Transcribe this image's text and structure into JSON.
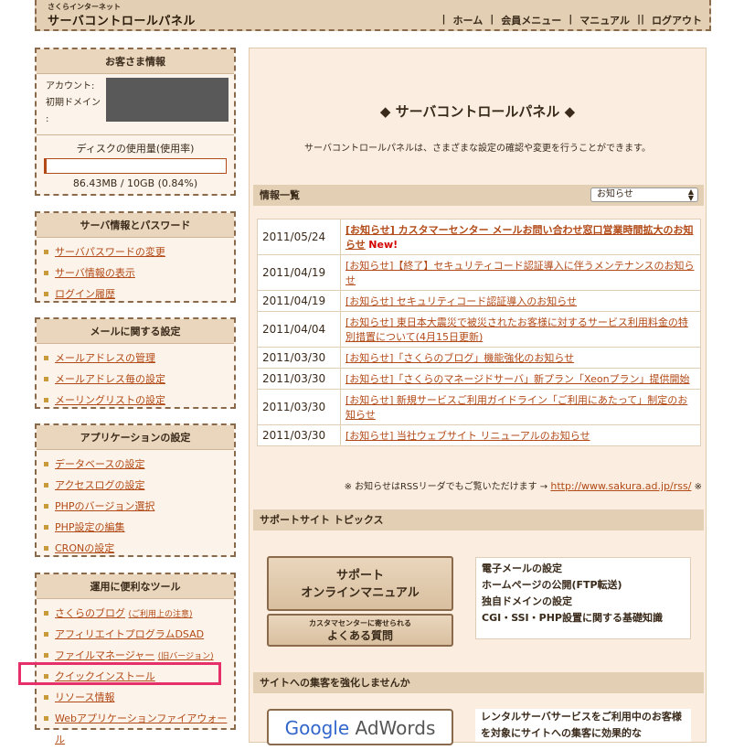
{
  "header": {
    "brand_small": "さくらインターネット",
    "brand_large": "サーバコントロールパネル",
    "nav": [
      "ホーム",
      "会員メニュー",
      "マニュアル",
      "ログアウト"
    ]
  },
  "customer": {
    "title": "お客さま情報",
    "account_label": "アカウント:",
    "domain_label_1": "初期ドメイン",
    "domain_label_2": ":",
    "disk_label": "ディスクの使用量(使用率)",
    "disk_usage": "86.43MB / 10GB (0.84%)",
    "disk_fraction": 0.0084
  },
  "server_info": {
    "title": "サーバ情報とパスワード",
    "items": [
      "サーバパスワードの変更",
      "サーバ情報の表示",
      "ログイン履歴"
    ]
  },
  "mail": {
    "title": "メールに関する設定",
    "items": [
      "メールアドレスの管理",
      "メールアドレス毎の設定",
      "メーリングリストの設定"
    ]
  },
  "apps": {
    "title": "アプリケーションの設定",
    "items": [
      "データベースの設定",
      "アクセスログの設定",
      "PHPのバージョン選択",
      "PHP設定の編集",
      "CRONの設定"
    ]
  },
  "tools": {
    "title": "運用に便利なツール",
    "items": [
      {
        "label": "さくらのブログ",
        "sub": "(ご利用上の注意)"
      },
      {
        "label": "アフィリエイトプログラムDSAD",
        "sub": ""
      },
      {
        "label": "ファイルマネージャー",
        "sub": "(旧バージョン)"
      },
      {
        "label": "クイックインストール",
        "sub": ""
      },
      {
        "label": "リソース情報",
        "sub": ""
      },
      {
        "label": "Webアプリケーションファイアウォール",
        "sub": ""
      }
    ]
  },
  "main": {
    "title": "◆ サーバコントロールパネル ◆",
    "description": "サーバコントロールパネルは、さまざまな設定の確認や変更を行うことができます。",
    "news_header": "情報一覧",
    "filter_selected": "お知らせ",
    "news": [
      {
        "date": "2011/05/24",
        "text": "[お知らせ] カスタマーセンター メールお問い合わせ窓口営業時間拡大のお知らせ",
        "flag": "New!",
        "bold": true
      },
      {
        "date": "2011/04/19",
        "text": "[お知らせ]【終了】セキュリティコード認証導入に伴うメンテナンスのお知らせ",
        "flag": "",
        "bold": false
      },
      {
        "date": "2011/04/19",
        "text": "[お知らせ] セキュリティコード認証導入のお知らせ",
        "flag": "",
        "bold": false
      },
      {
        "date": "2011/04/04",
        "text": "[お知らせ] 東日本大震災で被災されたお客様に対するサービス利用料金の特別措置について(4月15日更新)",
        "flag": "",
        "bold": false
      },
      {
        "date": "2011/03/30",
        "text": "[お知らせ]「さくらのブログ」機能強化のお知らせ",
        "flag": "",
        "bold": false
      },
      {
        "date": "2011/03/30",
        "text": "[お知らせ]「さくらのマネージドサーバ」新プラン「Xeonプラン」提供開始",
        "flag": "",
        "bold": false
      },
      {
        "date": "2011/03/30",
        "text": "[お知らせ] 新規サービスご利用ガイドライン「ご利用にあたって」制定のお知らせ",
        "flag": "",
        "bold": false
      },
      {
        "date": "2011/03/30",
        "text": "[お知らせ] 当社ウェブサイト リニューアルのお知らせ",
        "flag": "",
        "bold": false
      }
    ],
    "rss_note": "※ お知らせはRSSリーダでもご覧いただけます →",
    "rss_url": "http://www.sakura.ad.jp/rss/",
    "rss_end": "※",
    "support_header": "サポートサイト トピックス",
    "manual_button_1": "サポート",
    "manual_button_2": "オンラインマニュアル",
    "faq_button_small": "カスタマセンターに寄せられる",
    "faq_button_large": "よくある質問",
    "support_topics": [
      "電子メールの設定",
      "ホームページの公開(FTP転送)",
      "独自ドメインの設定",
      "CGI・SSI・PHP設置に関する基礎知識"
    ],
    "promo_header": "サイトへの集客を強化しませんか",
    "adwords_google": "Google",
    "adwords_text": "AdWords",
    "promo_text": "レンタルサーバサービスをご利用中のお客様を対象にサイトへの集客に効果的な"
  }
}
